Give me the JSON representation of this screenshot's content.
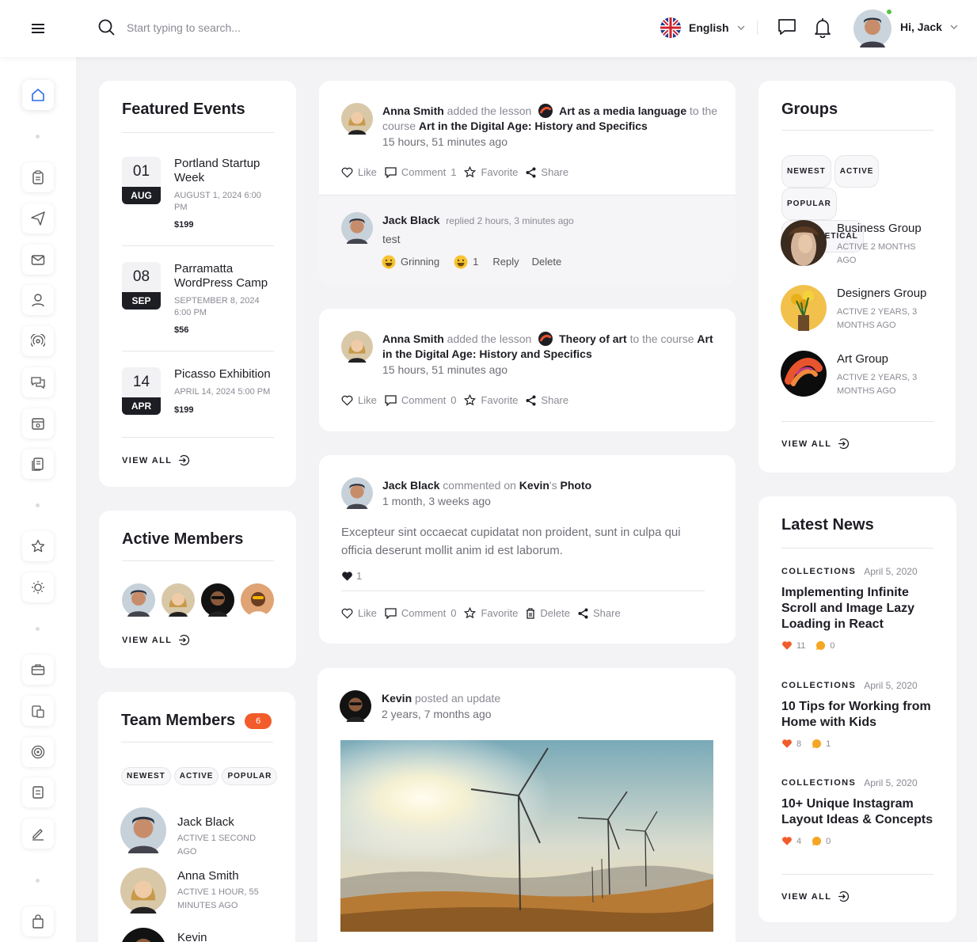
{
  "header": {
    "search_placeholder": "Start typing to search...",
    "language": "English",
    "greeting": "Hi,",
    "user_name": "Jack"
  },
  "featured_events": {
    "title": "Featured Events",
    "view_all": "VIEW ALL",
    "events": [
      {
        "day": "01",
        "month": "AUG",
        "title": "Portland Startup Week",
        "datetime": "AUGUST 1, 2024 6:00 PM",
        "price": "$199"
      },
      {
        "day": "08",
        "month": "SEP",
        "title": "Parramatta WordPress Camp",
        "datetime": "SEPTEMBER 8, 2024 6:00 PM",
        "price": "$56"
      },
      {
        "day": "14",
        "month": "APR",
        "title": "Picasso Exhibition",
        "datetime": "APRIL 14, 2024 5:00 PM",
        "price": "$199"
      }
    ]
  },
  "active_members": {
    "title": "Active Members",
    "view_all": "VIEW ALL"
  },
  "team_members": {
    "title": "Team Members",
    "count": "6",
    "tabs": [
      "NEWEST",
      "ACTIVE",
      "POPULAR"
    ],
    "members": [
      {
        "name": "Jack Black",
        "status": "ACTIVE 1 SECOND AGO"
      },
      {
        "name": "Anna Smith",
        "status": "ACTIVE 1 HOUR, 55 MINUTES AGO"
      },
      {
        "name": "Kevin",
        "status": ""
      }
    ]
  },
  "feed": {
    "post1": {
      "author": "Anna Smith",
      "verb": "added the lesson",
      "lesson": "Art as a media language",
      "to": "to the course",
      "course": "Art in the Digital Age: History and Specifics",
      "time": "15 hours, 51 minutes ago",
      "like": "Like",
      "comment": "Comment",
      "comment_count": "1",
      "favorite": "Favorite",
      "share": "Share",
      "reply": {
        "author": "Jack Black",
        "verb": "replied 2 hours, 3 minutes ago",
        "text": "test",
        "reaction": "Grinning",
        "reaction_count": "1",
        "reply_label": "Reply",
        "delete_label": "Delete"
      }
    },
    "post2": {
      "author": "Anna Smith",
      "verb": "added the lesson",
      "lesson": "Theory of art",
      "to": "to the course",
      "course_a": "Art",
      "course_b": "in the Digital Age: History and Specifics",
      "time": "15 hours, 51 minutes ago",
      "like": "Like",
      "comment": "Comment",
      "comment_count": "0",
      "favorite": "Favorite",
      "share": "Share"
    },
    "post3": {
      "author": "Jack Black",
      "verb": "commented on",
      "target": "Kevin",
      "target_suffix": "'s",
      "target_b": "Photo",
      "time": "1 month, 3 weeks ago",
      "body": "Excepteur sint occaecat cupidatat non proident, sunt in culpa qui officia deserunt mollit anim id est laborum.",
      "likes": "1",
      "like": "Like",
      "comment": "Comment",
      "comment_count": "0",
      "favorite": "Favorite",
      "delete": "Delete",
      "share": "Share"
    },
    "post4": {
      "author": "Kevin",
      "verb": "posted an update",
      "time": "2 years, 7 months ago"
    }
  },
  "groups": {
    "title": "Groups",
    "tabs": [
      "NEWEST",
      "ACTIVE",
      "POPULAR",
      "ALPHABETICAL"
    ],
    "view_all": "VIEW ALL",
    "items": [
      {
        "name": "Business Group",
        "status": "ACTIVE 2 MONTHS AGO"
      },
      {
        "name": "Designers Group",
        "status": "ACTIVE 2 YEARS, 3 MONTHS AGO"
      },
      {
        "name": "Art Group",
        "status": "ACTIVE 2 YEARS, 3 MONTHS AGO"
      }
    ]
  },
  "news": {
    "title": "Latest News",
    "view_all": "VIEW ALL",
    "items": [
      {
        "category": "COLLECTIONS",
        "date": "April 5, 2020",
        "title": "Implementing Infinite Scroll and Image Lazy Loading in React",
        "likes": "11",
        "comments": "0"
      },
      {
        "category": "COLLECTIONS",
        "date": "April 5, 2020",
        "title": "10 Tips for Working from Home with Kids",
        "likes": "8",
        "comments": "1"
      },
      {
        "category": "COLLECTIONS",
        "date": "April 5, 2020",
        "title": "10+ Unique Instagram Layout Ideas & Concepts",
        "likes": "4",
        "comments": "0"
      }
    ]
  },
  "colors": {
    "accent": "#f25c2a",
    "dark": "#1d1d24",
    "muted": "#8a8a94",
    "online": "#5bc04a"
  },
  "icons": [
    "menu-icon",
    "search-icon",
    "uk-flag-icon",
    "chat-icon",
    "bell-icon",
    "home-icon",
    "clipboard-icon",
    "send-icon",
    "mail-icon",
    "user-icon",
    "broadcast-icon",
    "messages-icon",
    "calendar-icon",
    "document-icon",
    "star-icon",
    "bulb-icon",
    "briefcase-icon",
    "copy-icon",
    "target-icon",
    "list-icon",
    "edit-icon",
    "bag-icon"
  ]
}
